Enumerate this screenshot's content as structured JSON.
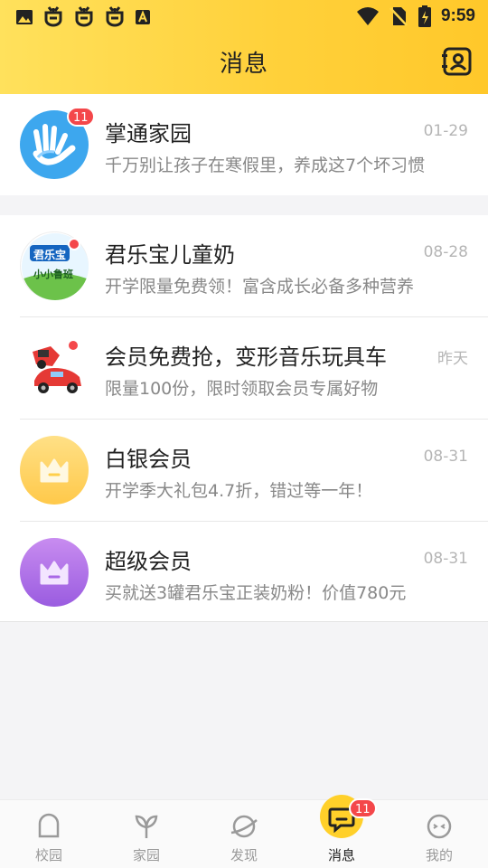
{
  "status_bar": {
    "time": "9:59",
    "icons": [
      "image-icon",
      "bug-icon",
      "bug-icon",
      "bug-icon",
      "a-box-icon",
      "wifi-icon",
      "no-sim-icon",
      "battery-charging-icon"
    ]
  },
  "header": {
    "title": "消息",
    "right_icon": "contacts-icon"
  },
  "colors": {
    "accent": "#ffd02a",
    "badge": "#f4474a",
    "primary_text": "#222222",
    "secondary_text": "#888888"
  },
  "messages_top": [
    {
      "name": "掌通家园",
      "date": "01-29",
      "preview": "千万别让孩子在寒假里，养成这7个坏习惯",
      "badge": "11",
      "icon": "hand-icon"
    }
  ],
  "messages": [
    {
      "name": "君乐宝儿童奶",
      "date": "08-28",
      "preview": "开学限量免费领！富含成长必备多种营养",
      "unread_dot": true,
      "icon": "brand-logo-icon",
      "logo_text_top": "君乐宝",
      "logo_text_bottom": "小小鲁班"
    },
    {
      "name": "会员免费抢，变形音乐玩具车",
      "date": "昨天",
      "preview": "限量100份，限时领取会员专属好物",
      "unread_dot": true,
      "icon": "toy-car-icon"
    },
    {
      "name": "白银会员",
      "date": "08-31",
      "preview": "开学季大礼包4.7折，错过等一年！",
      "icon": "crown-icon"
    },
    {
      "name": "超级会员",
      "date": "08-31",
      "preview": "买就送3罐君乐宝正装奶粉！价值780元",
      "icon": "crown-icon"
    }
  ],
  "tabs": [
    {
      "label": "校园",
      "icon": "school-icon",
      "active": false
    },
    {
      "label": "家园",
      "icon": "sprout-icon",
      "active": false
    },
    {
      "label": "发现",
      "icon": "planet-icon",
      "active": false
    },
    {
      "label": "消息",
      "icon": "chat-icon",
      "active": true,
      "badge": "11"
    },
    {
      "label": "我的",
      "icon": "face-icon",
      "active": false
    }
  ]
}
